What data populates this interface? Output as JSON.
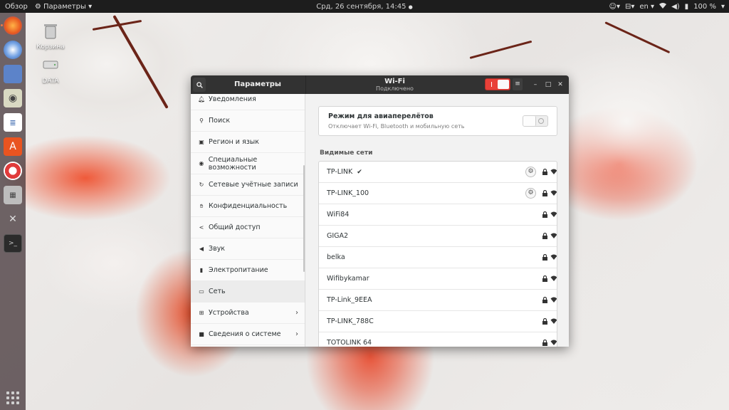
{
  "topbar": {
    "activities": "Обзор",
    "app_menu": "Параметры",
    "clock": "Срд, 26 сентября, 14:45",
    "language": "en",
    "battery": "100 %"
  },
  "desktop": {
    "icons": [
      {
        "label": "Корзина"
      },
      {
        "label": "DATA"
      }
    ]
  },
  "window": {
    "sidebar_title": "Параметры",
    "title": "Wi-Fi",
    "subtitle": "Подключено",
    "wifi_enabled": true
  },
  "sidebar": {
    "items": [
      {
        "label": "Уведомления",
        "icon": "bell-icon"
      },
      {
        "label": "Поиск",
        "icon": "search-icon"
      },
      {
        "label": "Регион и язык",
        "icon": "camera-icon"
      },
      {
        "label": "Специальные возможности",
        "icon": "accessibility-icon"
      },
      {
        "label": "Сетевые учётные записи",
        "icon": "refresh-icon"
      },
      {
        "label": "Конфиденциальность",
        "icon": "hand-icon"
      },
      {
        "label": "Общий доступ",
        "icon": "share-icon"
      },
      {
        "label": "Звук",
        "icon": "speaker-icon"
      },
      {
        "label": "Электропитание",
        "icon": "power-icon"
      },
      {
        "label": "Сеть",
        "icon": "network-icon"
      },
      {
        "label": "Устройства",
        "icon": "devices-icon"
      },
      {
        "label": "Сведения о системе",
        "icon": "info-icon"
      }
    ]
  },
  "airplane": {
    "label": "Режим для авиаперелётов",
    "description": "Отключает Wi-Fi, Bluetooth и мобильную сеть",
    "enabled": false
  },
  "networks": {
    "title": "Видимые сети",
    "items": [
      {
        "name": "TP-LINK",
        "connected": true,
        "settings": true
      },
      {
        "name": "TP-LINK_100",
        "connected": false,
        "settings": true
      },
      {
        "name": "WiFi84",
        "connected": false,
        "settings": false
      },
      {
        "name": "GIGA2",
        "connected": false,
        "settings": false
      },
      {
        "name": "belka",
        "connected": false,
        "settings": false
      },
      {
        "name": "Wifibykamar",
        "connected": false,
        "settings": false
      },
      {
        "name": "TP-Link_9EEA",
        "connected": false,
        "settings": false
      },
      {
        "name": "TP-LINK_788C",
        "connected": false,
        "settings": false
      },
      {
        "name": "TOTOLINK 64",
        "connected": false,
        "settings": false
      }
    ]
  },
  "colors": {
    "switch_on": "#e94038",
    "headerbar": "#323232",
    "topbar": "#1d1d1d",
    "dock": "#3c2c30"
  }
}
